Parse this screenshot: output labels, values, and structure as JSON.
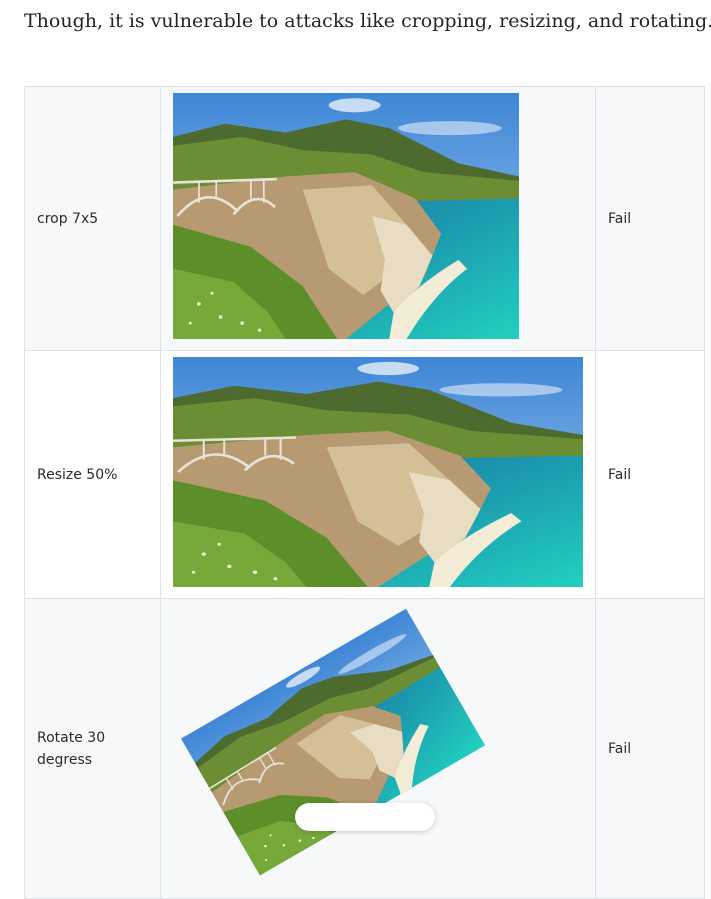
{
  "intro_text": "Though, it is vulnerable to attacks like cropping, resizing, and rotating.",
  "table": {
    "rows": [
      {
        "attack": "crop 7x5",
        "result": "Fail",
        "image_alt": "Coastal cliffs with arch bridge, cropped"
      },
      {
        "attack": "Resize 50%",
        "result": "Fail",
        "image_alt": "Coastal cliffs with arch bridge, resized"
      },
      {
        "attack": "Rotate 30 degress",
        "result": "Fail",
        "image_alt": "Coastal cliffs with arch bridge, rotated"
      }
    ]
  },
  "colors": {
    "border": "#dfe2e5",
    "row_shade": "#f6f8fa",
    "sky": "#5b9be0",
    "sea": "#1aa9b3",
    "grass": "#5c8f2a"
  }
}
